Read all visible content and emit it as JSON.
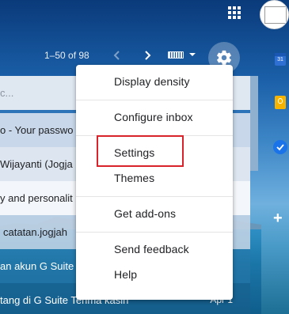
{
  "toolbar": {
    "pager_text": "1–50 of 98",
    "prev_icon": "chevron-left",
    "next_icon": "chevron-right",
    "keyboard_icon": "keyboard",
    "settings_icon": "gear"
  },
  "topbar": {
    "apps_icon": "grid-apps",
    "account_icon": "account-avatar"
  },
  "mail_rows": [
    {
      "subject": "c...",
      "date": ""
    },
    {
      "subject": "o - Your passwo",
      "date": ""
    },
    {
      "subject": "Wijayanti (Jogja",
      "date": ""
    },
    {
      "subject": "y and personalit",
      "date": ""
    },
    {
      "subject": "catatan.jogjah",
      "date": ""
    },
    {
      "subject": "an akun G Suite",
      "date": ""
    },
    {
      "subject": "tang di G Suite Terima kasih",
      "date": "Apr 1"
    }
  ],
  "menu": {
    "items": [
      "Display density",
      "Configure inbox",
      "Settings",
      "Themes",
      "Get add-ons",
      "Send feedback",
      "Help"
    ]
  },
  "side_panel": {
    "calendar_day": "31",
    "add_label": "+"
  },
  "colors": {
    "highlight": "#d8232a",
    "menu_bg": "#ffffff",
    "header_blue": "#0a3a7a"
  }
}
